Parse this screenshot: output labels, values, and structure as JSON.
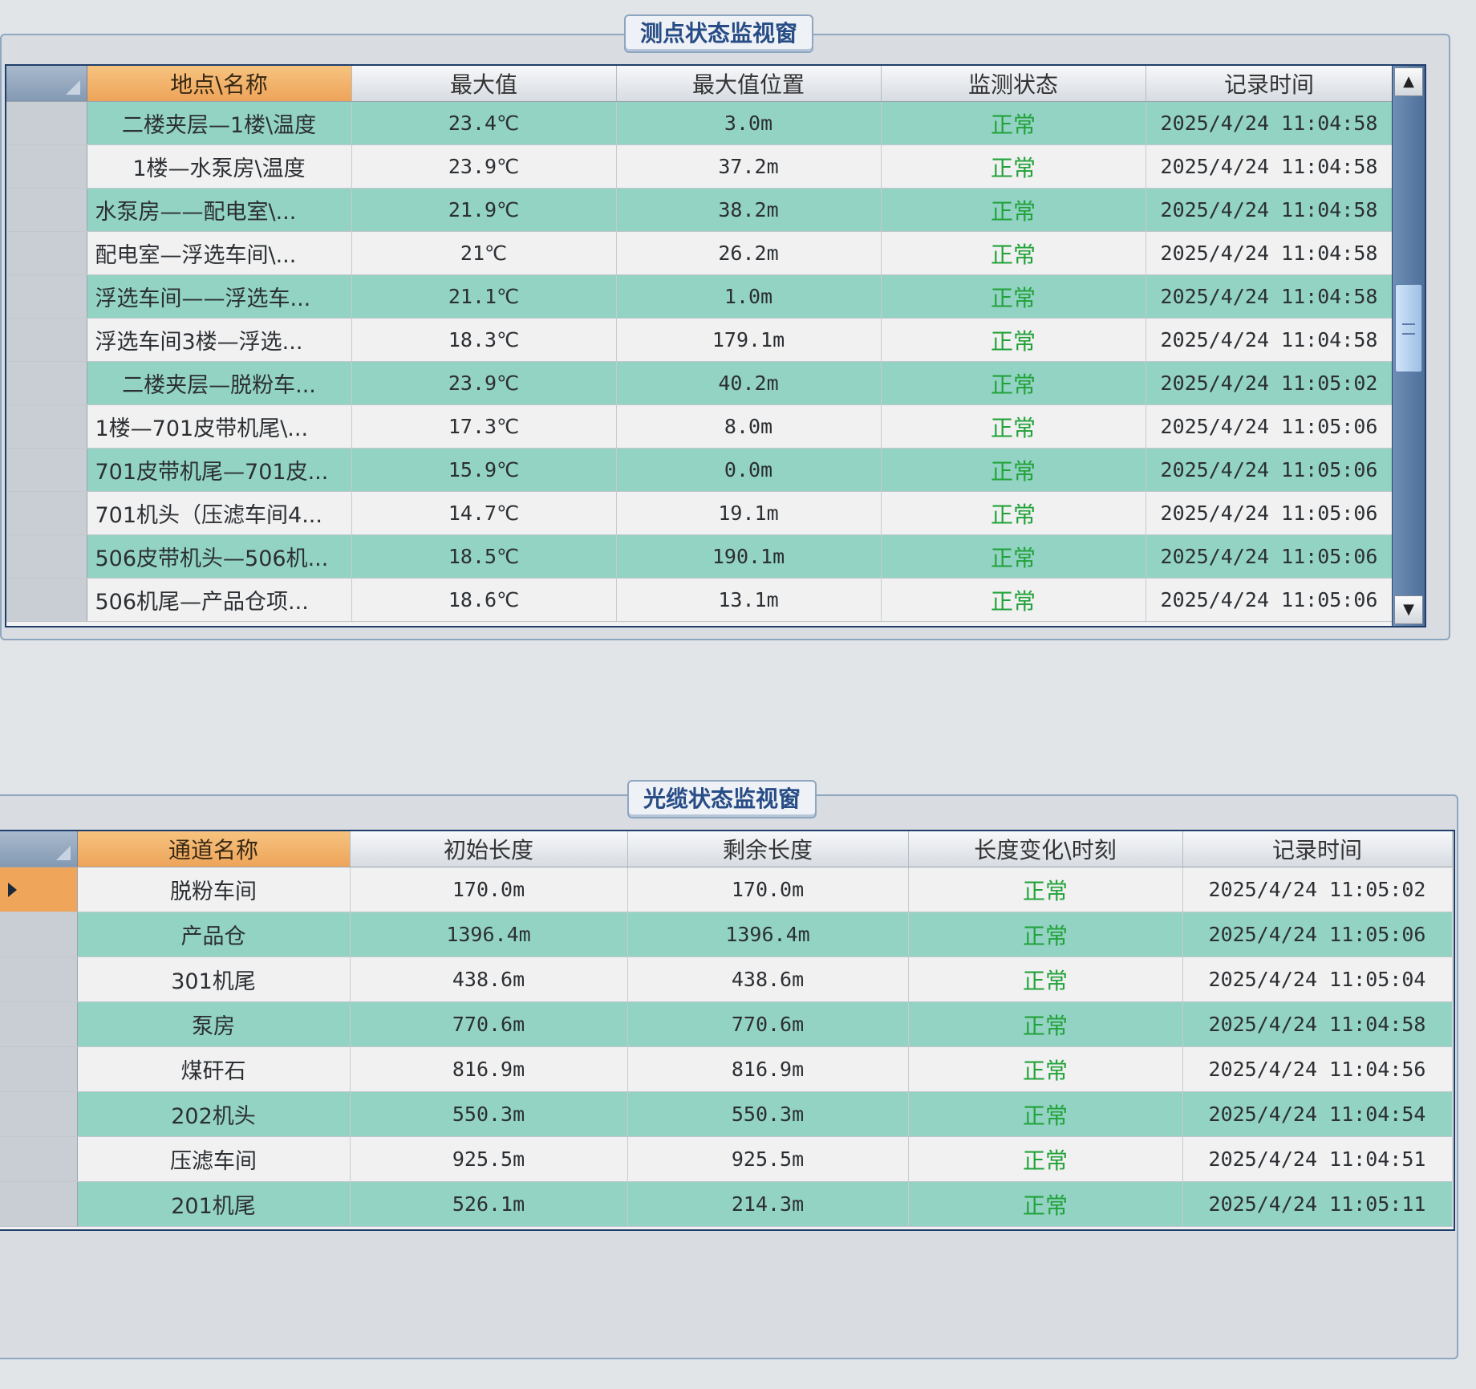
{
  "top_panel": {
    "title": "测点状态监视窗",
    "columns": [
      "地点\\名称",
      "最大值",
      "最大值位置",
      "监测状态",
      "记录时间"
    ],
    "rows": [
      {
        "name": "二楼夹层—1楼\\温度",
        "max": "23.4℃",
        "pos": "3.0m",
        "status": "正常",
        "time": "2025/4/24 11:04:58"
      },
      {
        "name": "1楼—水泵房\\温度",
        "max": "23.9℃",
        "pos": "37.2m",
        "status": "正常",
        "time": "2025/4/24 11:04:58"
      },
      {
        "name": "水泵房——配电室\\...",
        "max": "21.9℃",
        "pos": "38.2m",
        "status": "正常",
        "time": "2025/4/24 11:04:58"
      },
      {
        "name": "配电室—浮选车间\\...",
        "max": "21℃",
        "pos": "26.2m",
        "status": "正常",
        "time": "2025/4/24 11:04:58"
      },
      {
        "name": "浮选车间——浮选车...",
        "max": "21.1℃",
        "pos": "1.0m",
        "status": "正常",
        "time": "2025/4/24 11:04:58"
      },
      {
        "name": "浮选车间3楼—浮选...",
        "max": "18.3℃",
        "pos": "179.1m",
        "status": "正常",
        "time": "2025/4/24 11:04:58"
      },
      {
        "name": "二楼夹层—脱粉车...",
        "max": "23.9℃",
        "pos": "40.2m",
        "status": "正常",
        "time": "2025/4/24 11:05:02"
      },
      {
        "name": "1楼—701皮带机尾\\...",
        "max": "17.3℃",
        "pos": "8.0m",
        "status": "正常",
        "time": "2025/4/24 11:05:06"
      },
      {
        "name": "701皮带机尾—701皮...",
        "max": "15.9℃",
        "pos": "0.0m",
        "status": "正常",
        "time": "2025/4/24 11:05:06"
      },
      {
        "name": "701机头（压滤车间4...",
        "max": "14.7℃",
        "pos": "19.1m",
        "status": "正常",
        "time": "2025/4/24 11:05:06"
      },
      {
        "name": "506皮带机头—506机...",
        "max": "18.5℃",
        "pos": "190.1m",
        "status": "正常",
        "time": "2025/4/24 11:05:06"
      },
      {
        "name": "506机尾—产品仓项...",
        "max": "18.6℃",
        "pos": "13.1m",
        "status": "正常",
        "time": "2025/4/24 11:05:06"
      }
    ]
  },
  "bottom_panel": {
    "title": "光缆状态监视窗",
    "columns": [
      "通道名称",
      "初始长度",
      "剩余长度",
      "长度变化\\时刻",
      "记录时间"
    ],
    "rows": [
      {
        "name": "脱粉车间",
        "initial": "170.0m",
        "remain": "170.0m",
        "status": "正常",
        "time": "2025/4/24 11:05:02"
      },
      {
        "name": "产品仓",
        "initial": "1396.4m",
        "remain": "1396.4m",
        "status": "正常",
        "time": "2025/4/24 11:05:06"
      },
      {
        "name": "301机尾",
        "initial": "438.6m",
        "remain": "438.6m",
        "status": "正常",
        "time": "2025/4/24 11:05:04"
      },
      {
        "name": "泵房",
        "initial": "770.6m",
        "remain": "770.6m",
        "status": "正常",
        "time": "2025/4/24 11:04:58"
      },
      {
        "name": "煤矸石",
        "initial": "816.9m",
        "remain": "816.9m",
        "status": "正常",
        "time": "2025/4/24 11:04:56"
      },
      {
        "name": "202机头",
        "initial": "550.3m",
        "remain": "550.3m",
        "status": "正常",
        "time": "2025/4/24 11:04:54"
      },
      {
        "name": "压滤车间",
        "initial": "925.5m",
        "remain": "925.5m",
        "status": "正常",
        "time": "2025/4/24 11:04:51"
      },
      {
        "name": "201机尾",
        "initial": "526.1m",
        "remain": "214.3m",
        "status": "正常",
        "time": "2025/4/24 11:05:11"
      }
    ]
  },
  "icons": {
    "scroll_up": "triangle-up",
    "scroll_down": "triangle-down",
    "row_selector": "triangle-right"
  },
  "colors": {
    "alt_row": "#93d3c4",
    "header_accent": "#eea45a",
    "status_ok": "#22a23a",
    "title_text": "#274c86"
  }
}
